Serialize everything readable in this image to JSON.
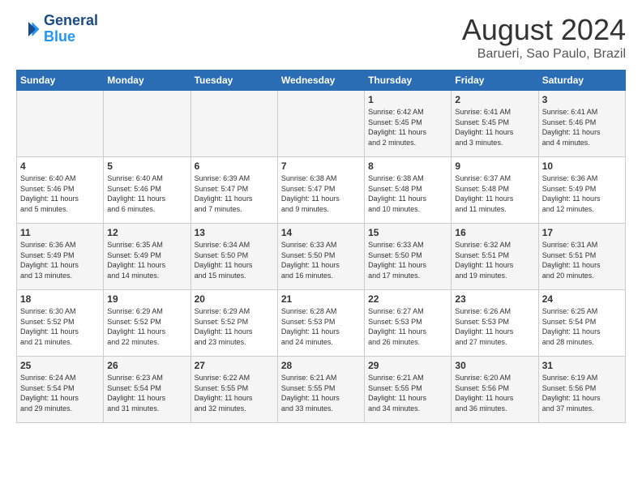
{
  "logo": {
    "line1": "General",
    "line2": "Blue"
  },
  "title": "August 2024",
  "location": "Barueri, Sao Paulo, Brazil",
  "headers": [
    "Sunday",
    "Monday",
    "Tuesday",
    "Wednesday",
    "Thursday",
    "Friday",
    "Saturday"
  ],
  "weeks": [
    [
      {
        "day": "",
        "info": ""
      },
      {
        "day": "",
        "info": ""
      },
      {
        "day": "",
        "info": ""
      },
      {
        "day": "",
        "info": ""
      },
      {
        "day": "1",
        "info": "Sunrise: 6:42 AM\nSunset: 5:45 PM\nDaylight: 11 hours\nand 2 minutes."
      },
      {
        "day": "2",
        "info": "Sunrise: 6:41 AM\nSunset: 5:45 PM\nDaylight: 11 hours\nand 3 minutes."
      },
      {
        "day": "3",
        "info": "Sunrise: 6:41 AM\nSunset: 5:46 PM\nDaylight: 11 hours\nand 4 minutes."
      }
    ],
    [
      {
        "day": "4",
        "info": "Sunrise: 6:40 AM\nSunset: 5:46 PM\nDaylight: 11 hours\nand 5 minutes."
      },
      {
        "day": "5",
        "info": "Sunrise: 6:40 AM\nSunset: 5:46 PM\nDaylight: 11 hours\nand 6 minutes."
      },
      {
        "day": "6",
        "info": "Sunrise: 6:39 AM\nSunset: 5:47 PM\nDaylight: 11 hours\nand 7 minutes."
      },
      {
        "day": "7",
        "info": "Sunrise: 6:38 AM\nSunset: 5:47 PM\nDaylight: 11 hours\nand 9 minutes."
      },
      {
        "day": "8",
        "info": "Sunrise: 6:38 AM\nSunset: 5:48 PM\nDaylight: 11 hours\nand 10 minutes."
      },
      {
        "day": "9",
        "info": "Sunrise: 6:37 AM\nSunset: 5:48 PM\nDaylight: 11 hours\nand 11 minutes."
      },
      {
        "day": "10",
        "info": "Sunrise: 6:36 AM\nSunset: 5:49 PM\nDaylight: 11 hours\nand 12 minutes."
      }
    ],
    [
      {
        "day": "11",
        "info": "Sunrise: 6:36 AM\nSunset: 5:49 PM\nDaylight: 11 hours\nand 13 minutes."
      },
      {
        "day": "12",
        "info": "Sunrise: 6:35 AM\nSunset: 5:49 PM\nDaylight: 11 hours\nand 14 minutes."
      },
      {
        "day": "13",
        "info": "Sunrise: 6:34 AM\nSunset: 5:50 PM\nDaylight: 11 hours\nand 15 minutes."
      },
      {
        "day": "14",
        "info": "Sunrise: 6:33 AM\nSunset: 5:50 PM\nDaylight: 11 hours\nand 16 minutes."
      },
      {
        "day": "15",
        "info": "Sunrise: 6:33 AM\nSunset: 5:50 PM\nDaylight: 11 hours\nand 17 minutes."
      },
      {
        "day": "16",
        "info": "Sunrise: 6:32 AM\nSunset: 5:51 PM\nDaylight: 11 hours\nand 19 minutes."
      },
      {
        "day": "17",
        "info": "Sunrise: 6:31 AM\nSunset: 5:51 PM\nDaylight: 11 hours\nand 20 minutes."
      }
    ],
    [
      {
        "day": "18",
        "info": "Sunrise: 6:30 AM\nSunset: 5:52 PM\nDaylight: 11 hours\nand 21 minutes."
      },
      {
        "day": "19",
        "info": "Sunrise: 6:29 AM\nSunset: 5:52 PM\nDaylight: 11 hours\nand 22 minutes."
      },
      {
        "day": "20",
        "info": "Sunrise: 6:29 AM\nSunset: 5:52 PM\nDaylight: 11 hours\nand 23 minutes."
      },
      {
        "day": "21",
        "info": "Sunrise: 6:28 AM\nSunset: 5:53 PM\nDaylight: 11 hours\nand 24 minutes."
      },
      {
        "day": "22",
        "info": "Sunrise: 6:27 AM\nSunset: 5:53 PM\nDaylight: 11 hours\nand 26 minutes."
      },
      {
        "day": "23",
        "info": "Sunrise: 6:26 AM\nSunset: 5:53 PM\nDaylight: 11 hours\nand 27 minutes."
      },
      {
        "day": "24",
        "info": "Sunrise: 6:25 AM\nSunset: 5:54 PM\nDaylight: 11 hours\nand 28 minutes."
      }
    ],
    [
      {
        "day": "25",
        "info": "Sunrise: 6:24 AM\nSunset: 5:54 PM\nDaylight: 11 hours\nand 29 minutes."
      },
      {
        "day": "26",
        "info": "Sunrise: 6:23 AM\nSunset: 5:54 PM\nDaylight: 11 hours\nand 31 minutes."
      },
      {
        "day": "27",
        "info": "Sunrise: 6:22 AM\nSunset: 5:55 PM\nDaylight: 11 hours\nand 32 minutes."
      },
      {
        "day": "28",
        "info": "Sunrise: 6:21 AM\nSunset: 5:55 PM\nDaylight: 11 hours\nand 33 minutes."
      },
      {
        "day": "29",
        "info": "Sunrise: 6:21 AM\nSunset: 5:55 PM\nDaylight: 11 hours\nand 34 minutes."
      },
      {
        "day": "30",
        "info": "Sunrise: 6:20 AM\nSunset: 5:56 PM\nDaylight: 11 hours\nand 36 minutes."
      },
      {
        "day": "31",
        "info": "Sunrise: 6:19 AM\nSunset: 5:56 PM\nDaylight: 11 hours\nand 37 minutes."
      }
    ]
  ]
}
